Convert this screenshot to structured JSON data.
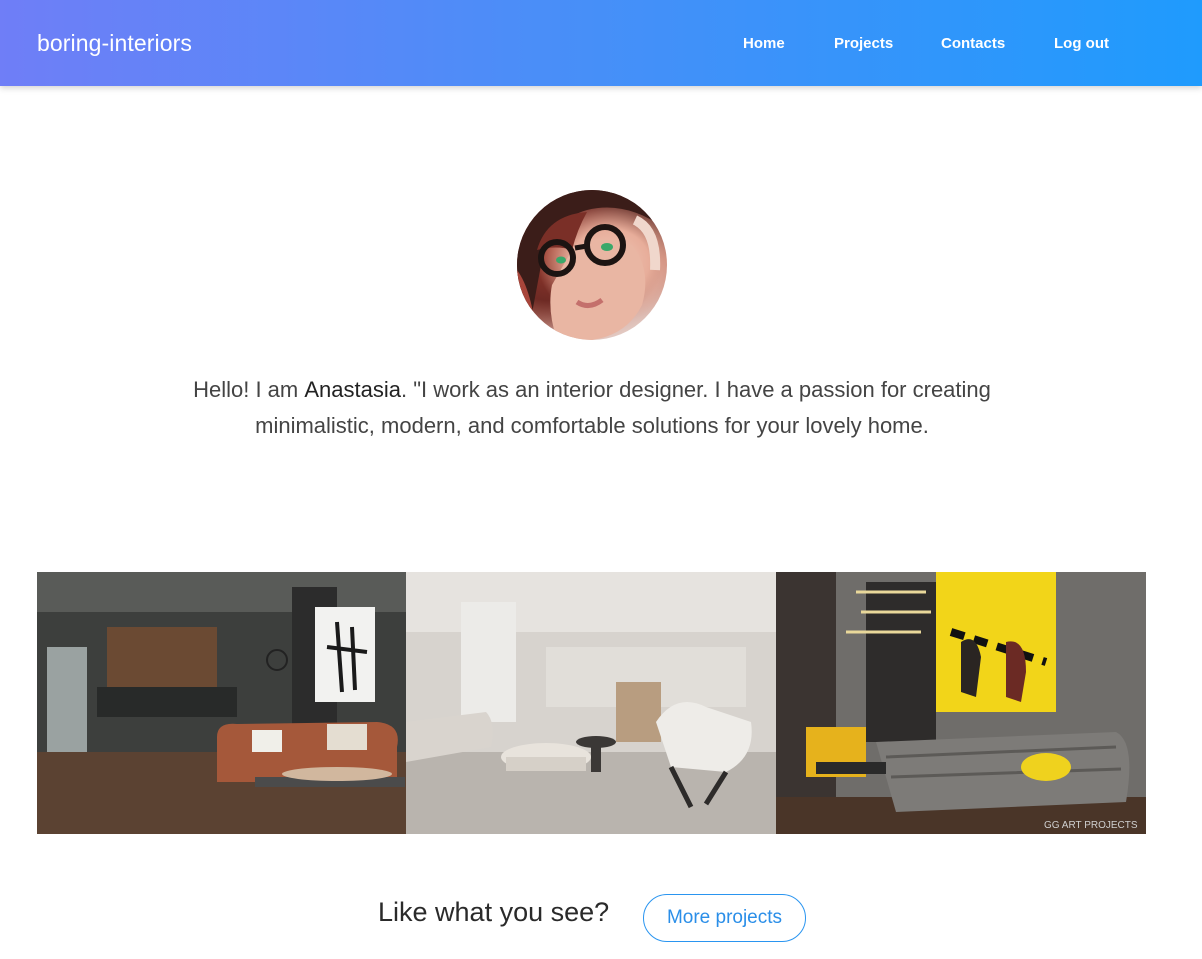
{
  "navbar": {
    "brand": "boring-interiors",
    "links": [
      {
        "label": "Home"
      },
      {
        "label": "Projects"
      },
      {
        "label": "Contacts"
      },
      {
        "label": "Log out"
      }
    ]
  },
  "intro": {
    "prefix": "Hello! I am ",
    "name": "Anastasia",
    "text": ". \"I work as an interior designer. I have a passion for creating minimalistic, modern, and comfortable solutions for your lovely home."
  },
  "gallery": {
    "watermark": "GG ART PROJECTS"
  },
  "cta": {
    "question": "Like what you see?",
    "button_label": "More projects"
  },
  "colors": {
    "nav_gradient_start": "#6f7ef7",
    "nav_gradient_end": "#1f9bfd",
    "button_accent": "#2a95f0"
  }
}
